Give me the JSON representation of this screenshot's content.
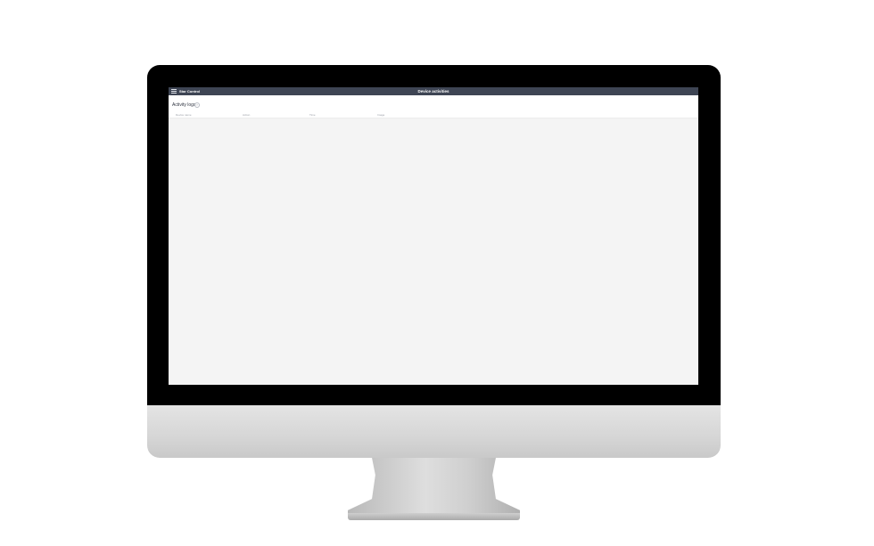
{
  "app": {
    "brand": "Star Control",
    "page_title": "Device activities"
  },
  "activity_logs": {
    "title": "Activity logs",
    "help_icon": "?",
    "columns": [
      "Device name",
      "Action",
      "Time",
      "Image"
    ]
  },
  "icons": {
    "menu": "hamburger-icon",
    "help": "question-circle-icon"
  },
  "colors": {
    "topbar": "#3e4554",
    "content_background": "#f4f4f4",
    "bezel": "#000000"
  }
}
